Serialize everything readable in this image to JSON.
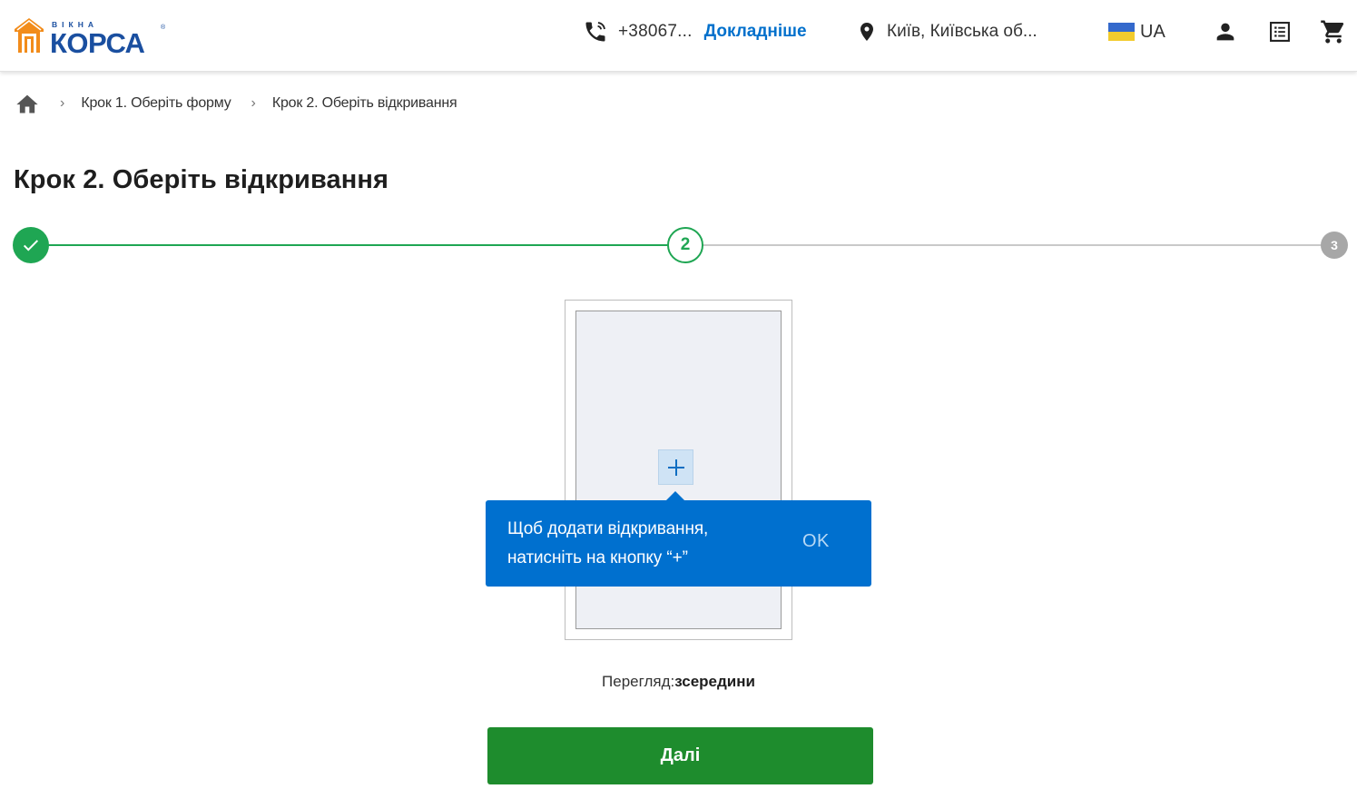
{
  "header": {
    "logo_top": "ВІКНА",
    "logo_brand": "КОРСА",
    "phone_icon": "phone-icon",
    "phone": "+38067...",
    "more_link": "Докладніше",
    "location_icon": "location-pin-icon",
    "location": "Київ, Київська об...",
    "language": "UA",
    "flag_colors": [
      "#3469cc",
      "#f2cb2d"
    ],
    "icons": [
      "user-icon",
      "orders-list-icon",
      "cart-icon"
    ]
  },
  "breadcrumb": {
    "home_icon": "home-icon",
    "items": [
      "Крок 1. Оберіть форму",
      "Крок 2. Оберіть відкривання"
    ]
  },
  "page_title": "Крок 2. Оберіть відкривання",
  "stepper": {
    "steps": [
      {
        "label": "",
        "status": "done"
      },
      {
        "label": "2",
        "status": "current"
      },
      {
        "label": "3",
        "status": "pending"
      }
    ],
    "colors": {
      "done": "#1fa653",
      "pending": "#a7a7a7"
    }
  },
  "constructor": {
    "add_button_symbol": "+",
    "tooltip": {
      "line1": "Щоб додати відкривання,",
      "line2": "натисніть на кнопку “+”",
      "ok": "OK"
    },
    "view_prefix": "Перегляд:",
    "view_value": "зсередини"
  },
  "next_button": "Далі",
  "colors": {
    "accent_blue": "#0070cf",
    "accent_green": "#1e8c2d",
    "logo_orange": "#f28c1b"
  }
}
